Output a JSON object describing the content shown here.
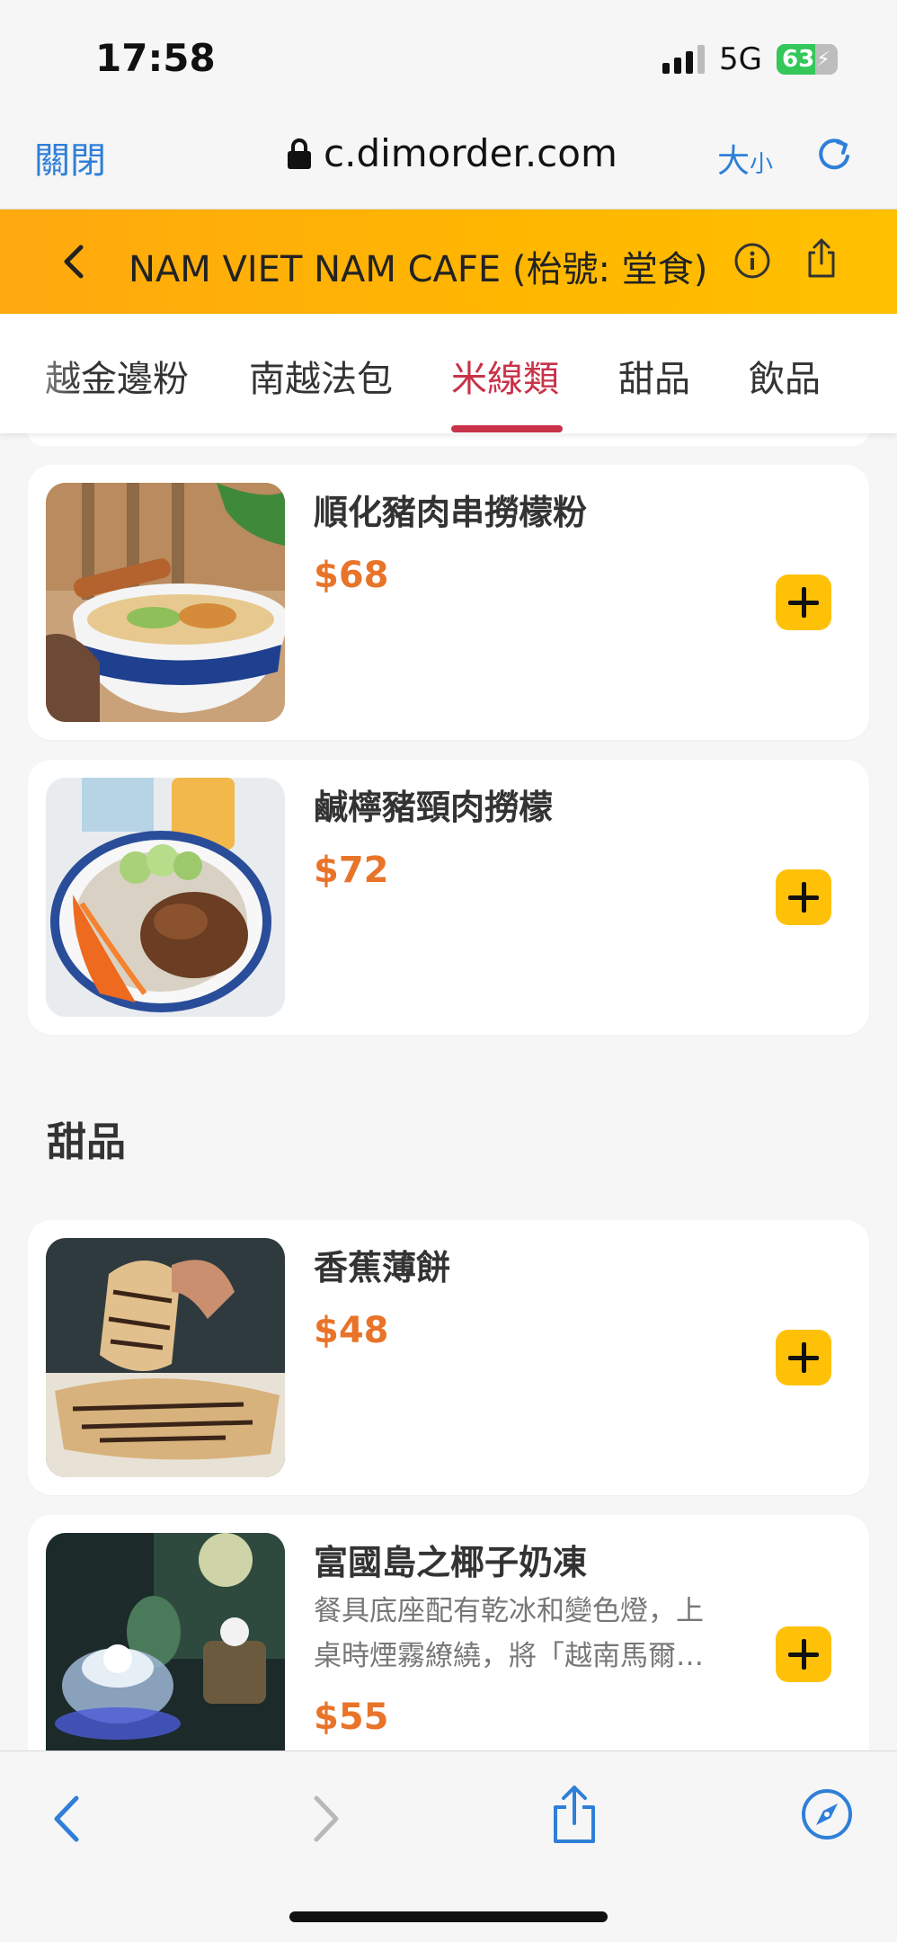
{
  "status": {
    "time": "17:58",
    "network": "5G",
    "battery": "63",
    "battery_level": 0.63
  },
  "browser": {
    "close_label": "關閉",
    "url": "c.dimorder.com",
    "text_size_big": "大",
    "text_size_small": "小"
  },
  "header": {
    "title": "NAM VIET NAM CAFE (枱號: 堂食)"
  },
  "tabs": [
    {
      "label": "越金邊粉",
      "active": false
    },
    {
      "label": "南越法包",
      "active": false
    },
    {
      "label": "米線類",
      "active": true
    },
    {
      "label": "甜品",
      "active": false
    },
    {
      "label": "飲品",
      "active": false
    }
  ],
  "items": [
    {
      "name": "順化豬肉串撈檬粉",
      "price": "$68",
      "description": ""
    },
    {
      "name": "鹹檸豬頸肉撈檬",
      "price": "$72",
      "description": ""
    },
    {
      "name": "香蕉薄餅",
      "price": "$48",
      "description": ""
    },
    {
      "name": "富國島之椰子奶凍",
      "price": "$55",
      "description": "餐具底座配有乾冰和變色燈，上桌時煙霧繚繞，將「越南馬爾…"
    }
  ],
  "sections": {
    "desserts": "甜品"
  },
  "icons": {
    "lock": "lock-icon",
    "reload": "reload-icon",
    "back": "chevron-left-icon",
    "info": "info-icon",
    "share": "share-icon",
    "add": "plus-icon",
    "nav_back": "chevron-left-icon",
    "nav_forward": "chevron-right-icon",
    "compass": "compass-icon"
  },
  "colors": {
    "accent_orange": "#ffb300",
    "active_tab": "#c8334a",
    "price": "#e8742a",
    "add_button": "#ffc107",
    "browser_blue": "#2f7fd8"
  }
}
